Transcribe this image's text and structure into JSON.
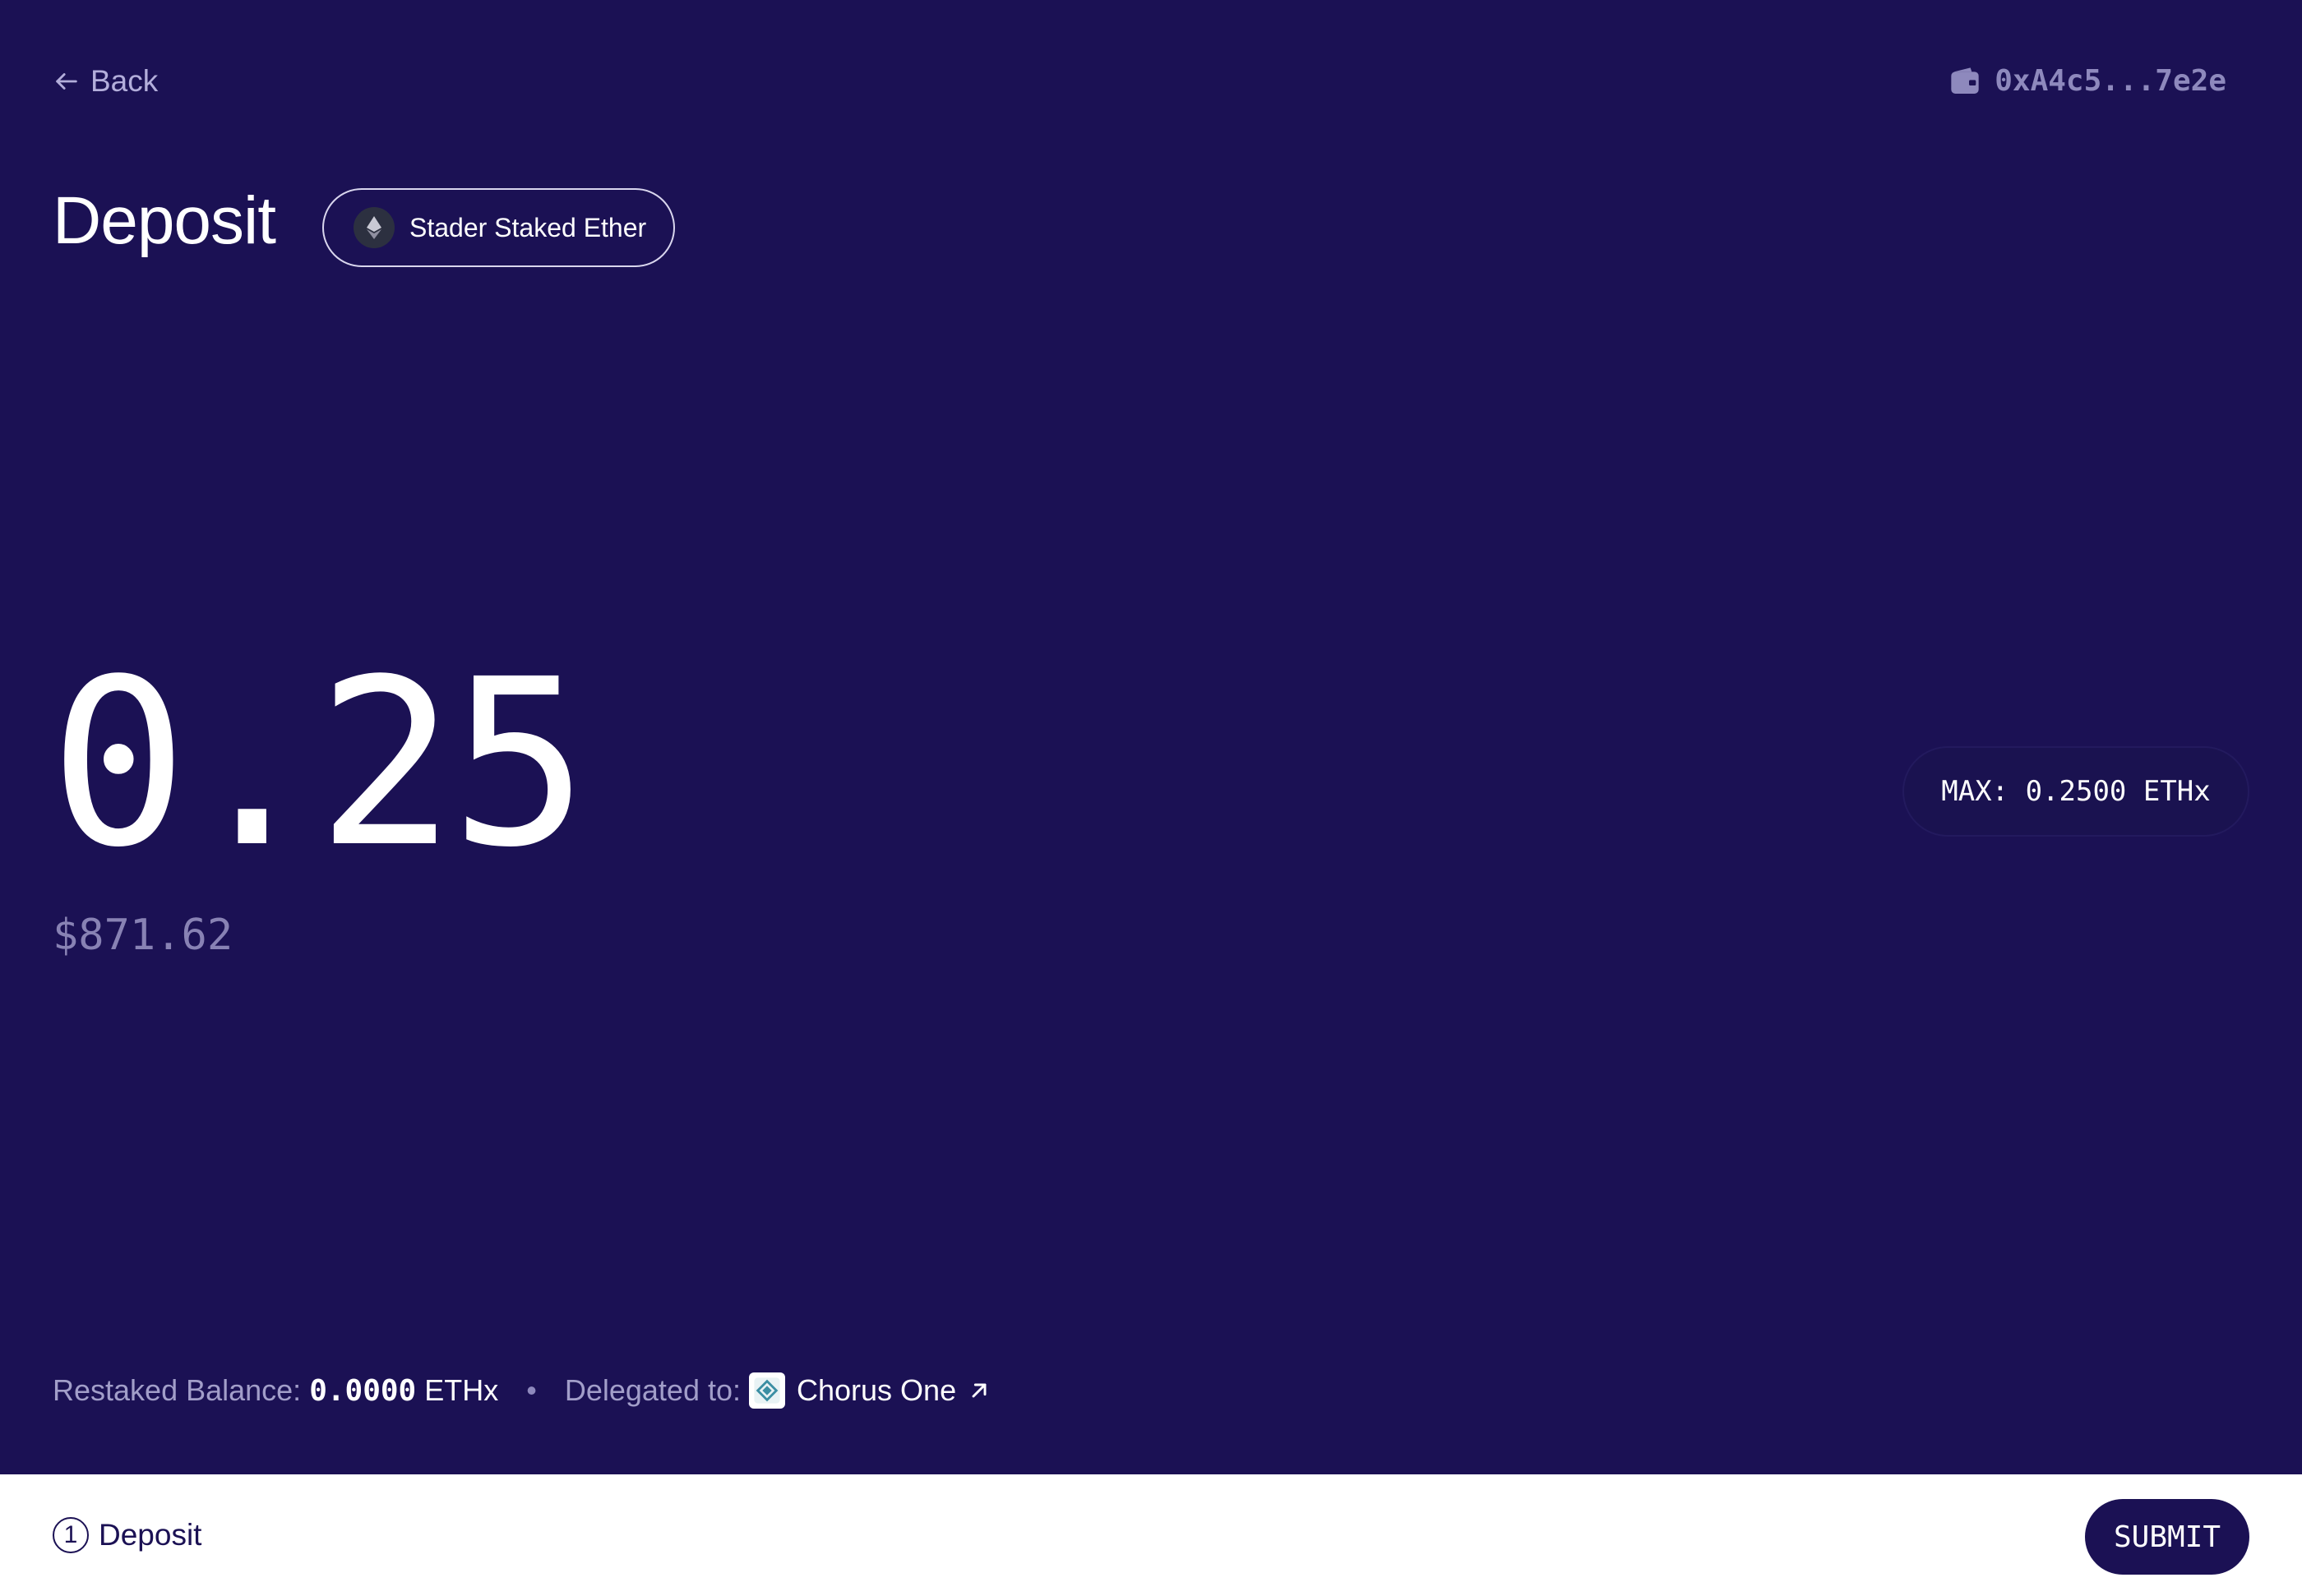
{
  "header": {
    "back_label": "Back",
    "wallet_address": "0xA4c5...7e2e"
  },
  "main": {
    "title": "Deposit",
    "token_name": "Stader Staked Ether",
    "amount": "0.25",
    "amount_usd": "$871.62",
    "max_label": "MAX: 0.2500 ETHx"
  },
  "info": {
    "restaked_label": "Restaked Balance:",
    "restaked_value": "0.0000",
    "restaked_unit": "ETHx",
    "separator": "•",
    "delegated_label": "Delegated to:",
    "operator_name": "Chorus One"
  },
  "footer": {
    "step_number": "1",
    "step_label": "Deposit",
    "submit_label": "SUBMIT"
  },
  "colors": {
    "background": "#1b1154",
    "footer_background": "#ffffff",
    "muted_text": "#a29ec9"
  },
  "icons": {
    "back": "arrow-left-icon",
    "wallet": "wallet-icon",
    "token": "ethereum-icon",
    "operator": "chorus-one-logo",
    "external": "external-link-icon"
  }
}
